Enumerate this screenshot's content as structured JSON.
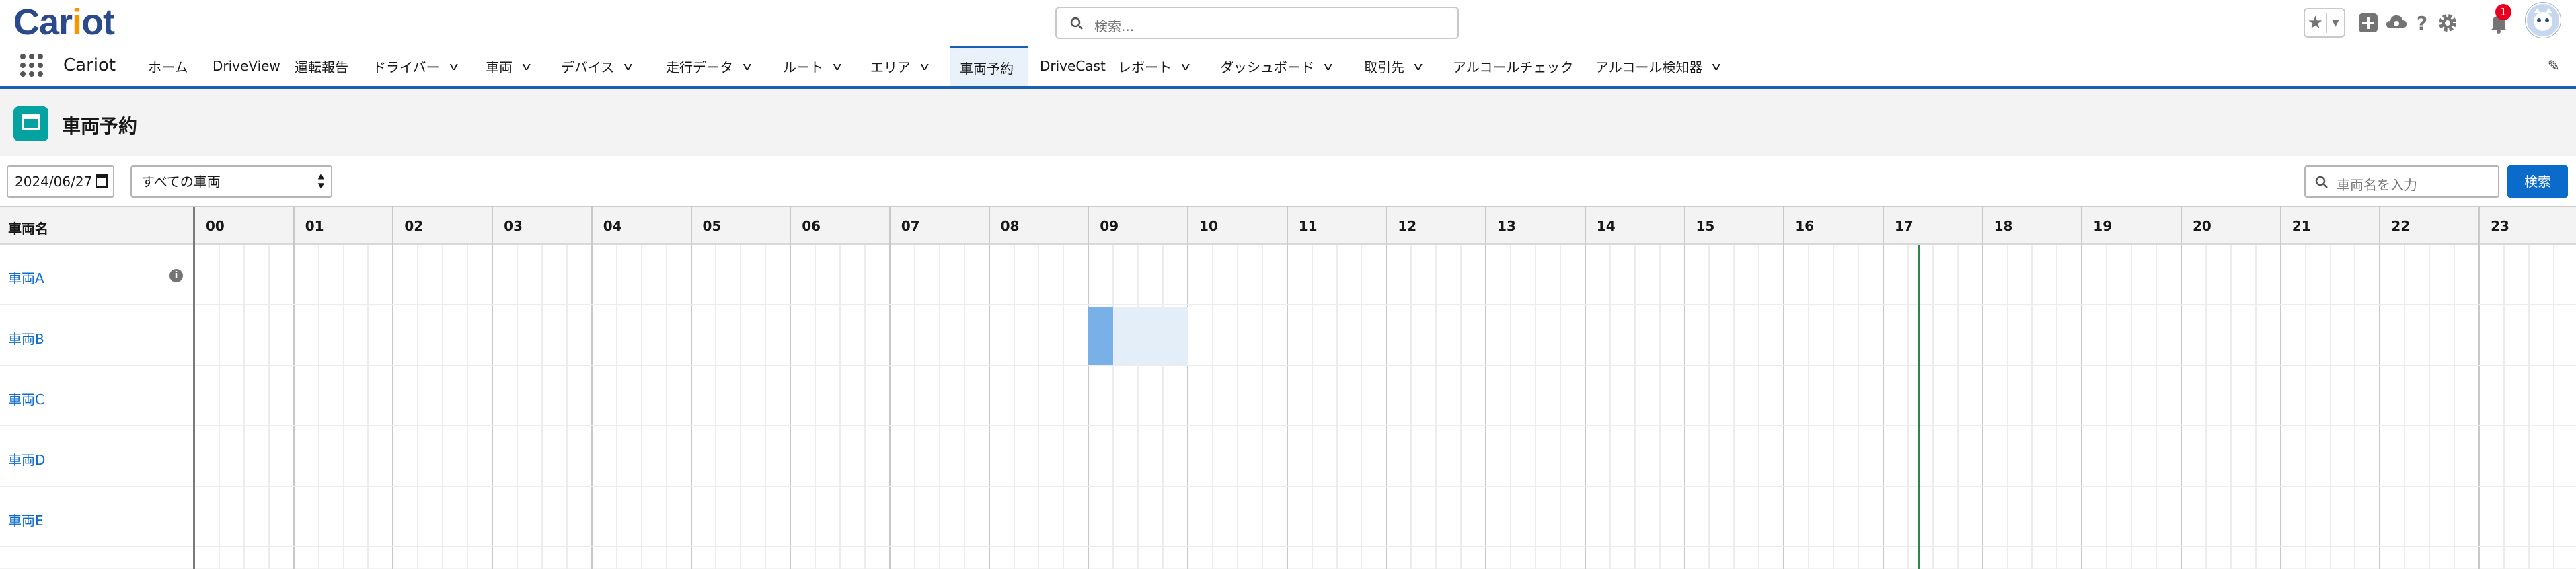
{
  "header": {
    "logo_main": "Car",
    "logo_accent": "i",
    "logo_tail": "ot",
    "search_placeholder": "検索...",
    "notification_count": "1",
    "icons": [
      "star-icon",
      "add-icon",
      "cloud-icon",
      "help-icon",
      "gear-icon",
      "bell-icon",
      "avatar"
    ]
  },
  "nav": {
    "app_name": "Cariot",
    "tabs": [
      {
        "label": "ホーム",
        "dropdown": false
      },
      {
        "label": "DriveView",
        "dropdown": false
      },
      {
        "label": "運転報告",
        "dropdown": false
      },
      {
        "label": "ドライバー",
        "dropdown": true
      },
      {
        "label": "車両",
        "dropdown": true
      },
      {
        "label": "デバイス",
        "dropdown": true
      },
      {
        "label": "走行データ",
        "dropdown": true
      },
      {
        "label": "ルート",
        "dropdown": true
      },
      {
        "label": "エリア",
        "dropdown": true
      },
      {
        "label": "車両予約",
        "dropdown": false,
        "active": true
      },
      {
        "label": "DriveCast",
        "dropdown": false
      },
      {
        "label": "レポート",
        "dropdown": true
      },
      {
        "label": "ダッシュボード",
        "dropdown": true
      },
      {
        "label": "取引先",
        "dropdown": true
      },
      {
        "label": "アルコールチェック",
        "dropdown": false
      },
      {
        "label": "アルコール検知器",
        "dropdown": true
      }
    ]
  },
  "page": {
    "title": "車両予約"
  },
  "filters": {
    "date": "2024/06/27",
    "vehicle_select": "すべての車両",
    "vehicle_search_placeholder": "車両名を入力",
    "search_button": "検索"
  },
  "schedule": {
    "column_header": "車両名",
    "hours": [
      "00",
      "01",
      "02",
      "03",
      "04",
      "05",
      "06",
      "07",
      "08",
      "09",
      "10",
      "11",
      "12",
      "13",
      "14",
      "15",
      "16",
      "17",
      "18",
      "19",
      "20",
      "21",
      "22",
      "23"
    ],
    "current_time_hour": 17.35,
    "vehicles": [
      {
        "name": "車両A",
        "info": true
      },
      {
        "name": "車両B",
        "info": false
      },
      {
        "name": "車両C",
        "info": false
      },
      {
        "name": "車両D",
        "info": false
      },
      {
        "name": "車両E",
        "info": false
      }
    ],
    "reservations": [
      {
        "vehicle_index": 1,
        "start": 9.0,
        "end": 9.25,
        "style": "dark"
      },
      {
        "vehicle_index": 1,
        "start": 9.25,
        "end": 10.0,
        "style": "light"
      }
    ],
    "colors": {
      "accent": "#1b5fb4",
      "link": "#0b6bcb",
      "reservation_dark": "#7ab0e8",
      "reservation_light": "#e3eef9",
      "now_line": "#2e844a",
      "page_icon": "#04a2a0"
    }
  }
}
